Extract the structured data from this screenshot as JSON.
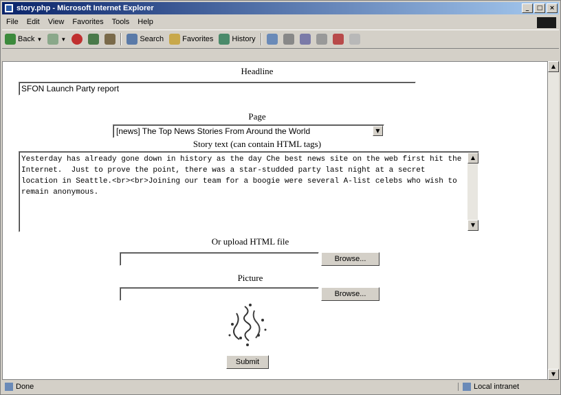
{
  "window": {
    "title": "story.php - Microsoft Internet Explorer"
  },
  "menubar": {
    "items": [
      "File",
      "Edit",
      "View",
      "Favorites",
      "Tools",
      "Help"
    ]
  },
  "toolbar": {
    "back": "Back",
    "search": "Search",
    "favorites": "Favorites",
    "history": "History"
  },
  "form": {
    "headline_label": "Headline",
    "headline_value": "SFON Launch Party report",
    "page_label": "Page",
    "page_selected": "[news] The Top News Stories From Around the World",
    "story_label": "Story text (can contain HTML tags)",
    "story_value": "Yesterday has already gone down in history as the day Che best news site on the web first hit the Internet.  Just to prove the point, there was a star-studded party last night at a secret location in Seattle.<br><br>Joining our team for a boogie were several A-list celebs who wish to remain anonymous.",
    "upload_label": "Or upload HTML file",
    "upload_browse": "Browse...",
    "picture_label": "Picture",
    "picture_browse": "Browse...",
    "submit": "Submit"
  },
  "statusbar": {
    "status": "Done",
    "zone": "Local intranet"
  }
}
